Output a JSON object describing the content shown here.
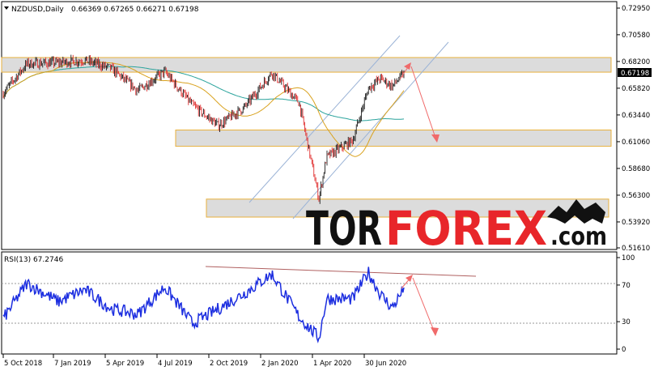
{
  "header": {
    "symbol": "NZDUSD,Daily",
    "ohlc": "0.66369 0.67265 0.66271 0.67198"
  },
  "price_axis": {
    "ticks": [
      "0.72950",
      "0.70580",
      "0.68200",
      "0.65820",
      "0.63440",
      "0.61060",
      "0.58680",
      "0.56300",
      "0.53920",
      "0.51610"
    ],
    "current_price": "0.67198"
  },
  "rsi": {
    "label": "RSI(13) 67.2746",
    "ticks": [
      "100",
      "70",
      "30",
      "0"
    ]
  },
  "time_axis": {
    "labels": [
      "5 Oct 2018",
      "7 Jan 2019",
      "5 Apr 2019",
      "4 Jul 2019",
      "2 Oct 2019",
      "2 Jan 2020",
      "1 Apr 2020",
      "30 Jun 2020"
    ]
  },
  "logo": {
    "part1": "TOR",
    "part2": "FOREX",
    "part3": ".com"
  },
  "colors": {
    "bull_candle": "#1e1e1e",
    "bear_candle": "#e03030",
    "ma_fast": "#d9a21e",
    "ma_slow": "#2aa39c",
    "rsi_line": "#1c2ee0",
    "zone_fill": "#d6d6d6",
    "zone_border": "#e8b13c",
    "channel": "#9bb3d6",
    "forecast_arrow": "#f06a6a",
    "rsi_trendline": "#b06060",
    "logo_black": "#111111",
    "logo_red": "#e8262a"
  },
  "chart_data": [
    {
      "type": "candlestick",
      "symbol": "NZDUSD",
      "timeframe": "Daily",
      "x_range": [
        "2018-10-05",
        "2020-08-10"
      ],
      "y_range": [
        0.5161,
        0.7295
      ],
      "approx_close_path": [
        {
          "date": "2018-10-05",
          "close": 0.653
        },
        {
          "date": "2018-11-15",
          "close": 0.68
        },
        {
          "date": "2019-01-07",
          "close": 0.681
        },
        {
          "date": "2019-02-20",
          "close": 0.683
        },
        {
          "date": "2019-04-05",
          "close": 0.676
        },
        {
          "date": "2019-05-20",
          "close": 0.656
        },
        {
          "date": "2019-07-04",
          "close": 0.673
        },
        {
          "date": "2019-08-20",
          "close": 0.643
        },
        {
          "date": "2019-10-02",
          "close": 0.625
        },
        {
          "date": "2019-11-15",
          "close": 0.641
        },
        {
          "date": "2019-12-31",
          "close": 0.672
        },
        {
          "date": "2020-02-15",
          "close": 0.645
        },
        {
          "date": "2020-03-19",
          "close": 0.56
        },
        {
          "date": "2020-04-01",
          "close": 0.597
        },
        {
          "date": "2020-05-15",
          "close": 0.612
        },
        {
          "date": "2020-06-10",
          "close": 0.658
        },
        {
          "date": "2020-06-30",
          "close": 0.667
        },
        {
          "date": "2020-07-20",
          "close": 0.66
        },
        {
          "date": "2020-08-10",
          "close": 0.672
        }
      ],
      "zones": [
        {
          "from": 0.6725,
          "to": 0.6855
        },
        {
          "from": 0.6065,
          "to": 0.621
        },
        {
          "from": 0.5435,
          "to": 0.5595
        }
      ],
      "last_close": 0.67198,
      "ohlc_last": {
        "open": 0.66369,
        "high": 0.67265,
        "low": 0.66271,
        "close": 0.67198
      }
    },
    {
      "type": "line",
      "name": "RSI(13)",
      "y_range": [
        0,
        100
      ],
      "levels": [
        30,
        70
      ],
      "last_value": 67.2746,
      "approx_path": [
        {
          "date": "2018-10-05",
          "value": 32
        },
        {
          "date": "2018-11-15",
          "value": 72
        },
        {
          "date": "2019-01-07",
          "value": 52
        },
        {
          "date": "2019-02-20",
          "value": 65
        },
        {
          "date": "2019-04-05",
          "value": 44
        },
        {
          "date": "2019-05-20",
          "value": 38
        },
        {
          "date": "2019-07-04",
          "value": 68
        },
        {
          "date": "2019-08-20",
          "value": 28
        },
        {
          "date": "2019-10-02",
          "value": 44
        },
        {
          "date": "2019-11-15",
          "value": 61
        },
        {
          "date": "2019-12-31",
          "value": 82
        },
        {
          "date": "2020-02-15",
          "value": 35
        },
        {
          "date": "2020-03-19",
          "value": 12
        },
        {
          "date": "2020-04-01",
          "value": 55
        },
        {
          "date": "2020-05-15",
          "value": 55
        },
        {
          "date": "2020-06-10",
          "value": 84
        },
        {
          "date": "2020-06-30",
          "value": 60
        },
        {
          "date": "2020-07-20",
          "value": 45
        },
        {
          "date": "2020-08-10",
          "value": 67
        }
      ]
    }
  ]
}
